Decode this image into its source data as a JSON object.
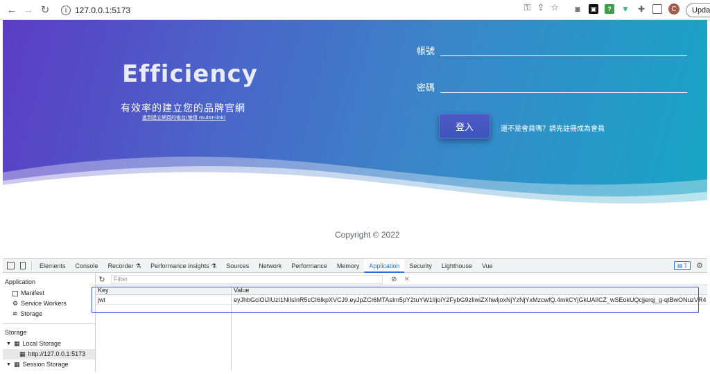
{
  "browser": {
    "url": "127.0.0.1:5173",
    "back_icon": "arrow-left-icon",
    "forward_icon": "arrow-right-icon",
    "reload_icon": "reload-icon",
    "avatar_letter": "C",
    "update_label": "Upda"
  },
  "hero": {
    "brand": "Efficiency",
    "tagline": "有效率的建立您的品牌官網",
    "sublink": "進到建立網頁的後台(使用 router-link)",
    "username_label": "帳號",
    "password_label": "密碼",
    "login_label": "登入",
    "register_text": "還不是會員嗎？請先註冊成為會員"
  },
  "footer": {
    "copyright": "Copyright © 2022"
  },
  "devtools": {
    "tabs": [
      "Elements",
      "Console",
      "Recorder ⚗",
      "Performance insights ⚗",
      "Sources",
      "Network",
      "Performance",
      "Memory",
      "Application",
      "Security",
      "Lighthouse",
      "Vue"
    ],
    "active_tab": "Application",
    "message_count": "1",
    "sidebar": {
      "application_heading": "Application",
      "manifest": "Manifest",
      "service_workers": "Service Workers",
      "storage": "Storage",
      "storage_heading": "Storage",
      "local_storage": "Local Storage",
      "local_origin": "http://127.0.0.1:5173",
      "session_storage": "Session Storage"
    },
    "filter_placeholder": "Filter",
    "table": {
      "headers": [
        "Key",
        "Value"
      ],
      "rows": [
        {
          "key": "jwt",
          "value": "eyJhbGciOiJIUzI1NiIsInR5cCI6IkpXVCJ9.eyJpZCI6MTAsIm5pY2tuYW1lIjoiY2FybG9zIiwiZXhwIjoxNjYzNjYxMzcwfQ.4mkCYjGkUAIlCZ_wSEokUQcjjerqj_g-qtBwONuzVR4"
        }
      ]
    }
  }
}
